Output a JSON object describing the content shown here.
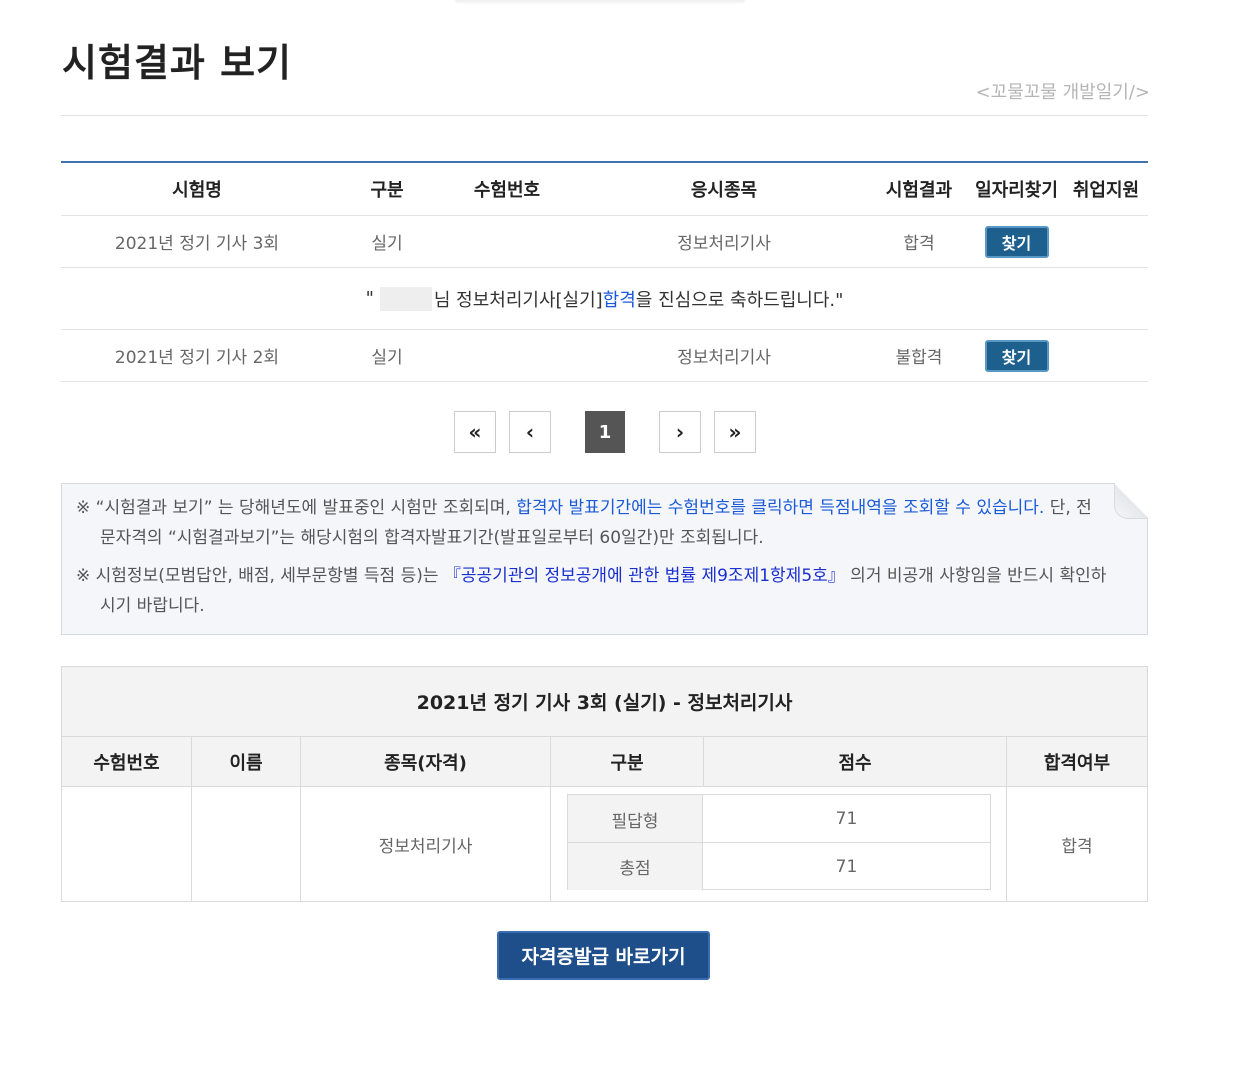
{
  "page": {
    "title": "시험결과 보기",
    "watermark": "<꼬물꼬물 개발일기/>"
  },
  "results_table": {
    "headers": [
      "시험명",
      "구분",
      "수험번호",
      "응시종목",
      "시험결과",
      "일자리찾기",
      "취업지원"
    ],
    "rows": [
      {
        "exam": "2021년 정기 기사 3회",
        "type": "실기",
        "number": "",
        "subject": "정보처리기사",
        "result": "합격",
        "button": "찾기"
      },
      {
        "exam": "2021년 정기 기사 2회",
        "type": "실기",
        "number": "",
        "subject": "정보처리기사",
        "result": "불합격",
        "button": "찾기"
      }
    ],
    "congrats": {
      "prefix": "\"",
      "name_suffix": "님 정보처리기사[실기] ",
      "highlight": "합격",
      "suffix": "을 진심으로 축하드립니다.\""
    }
  },
  "pagination": {
    "first": "«",
    "prev": "‹",
    "current": "1",
    "next": "›",
    "last": "»"
  },
  "notice": {
    "line1_a": "※ “시험결과 보기” 는 당해년도에 발표중인 시험만 조회되며, ",
    "line1_link": "합격자 발표기간에는 수험번호를 클릭하면 득점내역을 조회할 수 있습니다.",
    "line1_b": " 단, 전문자격의 “시험결과보기”는 해당시험의 합격자발표기간(발표일로부터 60일간)만 조회됩니다.",
    "line2_a": "※ 시험정보(모범답안, 배점, 세부문항별 득점 등)는 ",
    "line2_link": "『공공기관의 정보공개에 관한 법률 제9조제1항제5호』",
    "line2_b": " 의거 비공개 사항임을 반드시 확인하시기 바랍니다."
  },
  "detail": {
    "heading": "2021년 정기 기사 3회 (실기) - 정보처리기사",
    "columns": [
      "수험번호",
      "이름",
      "종목(자격)",
      "구분",
      "점수",
      "합격여부"
    ],
    "number": "",
    "name": "",
    "subject": "정보처리기사",
    "scores": [
      {
        "label": "필답형",
        "value": "71"
      },
      {
        "label": "총점",
        "value": "71"
      }
    ],
    "pass": "합격"
  },
  "cert_button": "자격증발급 바로가기"
}
